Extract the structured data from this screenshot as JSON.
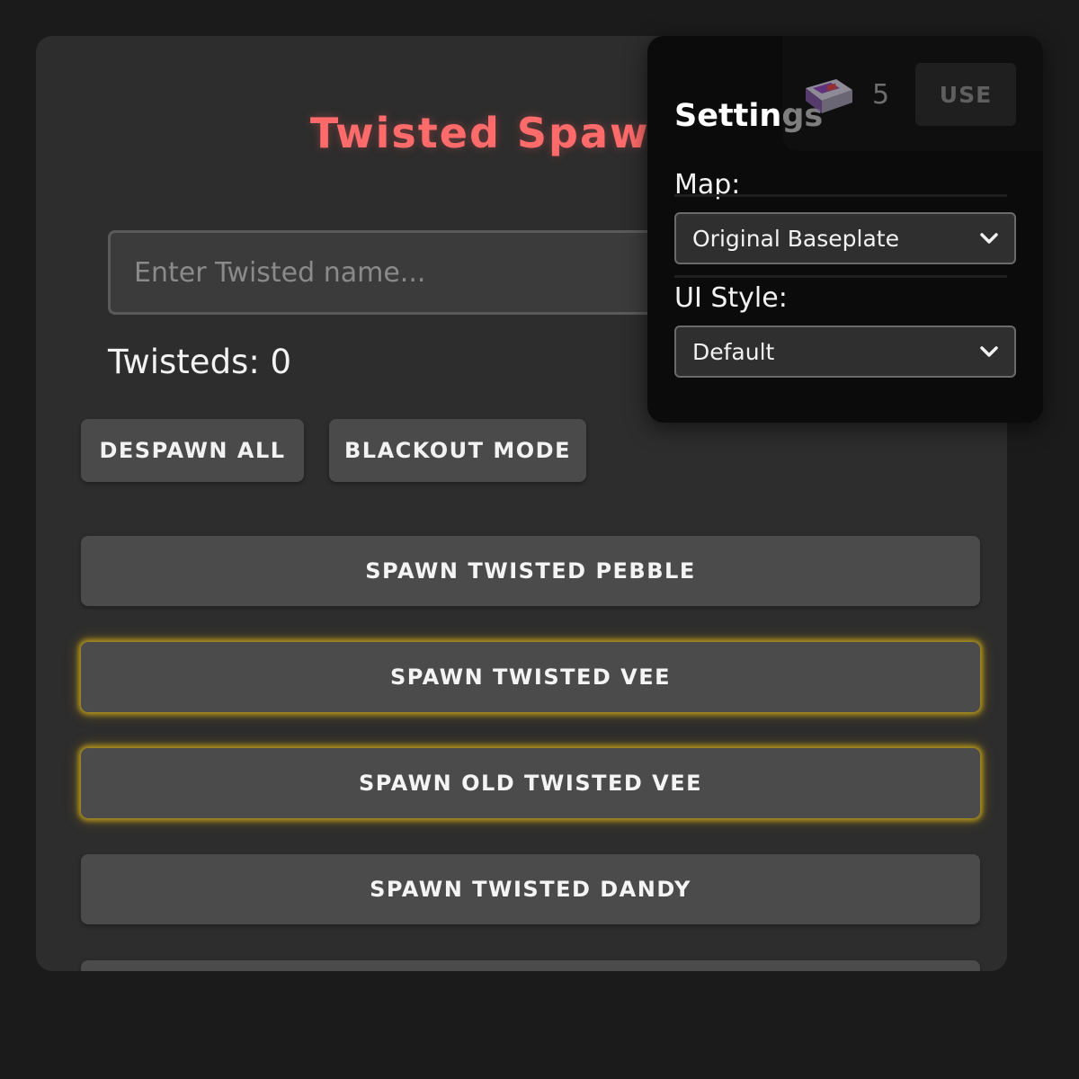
{
  "app": {
    "title": "Twisted Spawner",
    "search": {
      "placeholder": "Enter Twisted name...",
      "value": ""
    },
    "count_label": "Twisteds: 0",
    "actions": {
      "despawn_all": "DESPAWN ALL",
      "blackout_mode": "BLACKOUT MODE"
    },
    "spawn_buttons": [
      {
        "label": "SPAWN TWISTED PEBBLE",
        "highlighted": false
      },
      {
        "label": "SPAWN TWISTED VEE",
        "highlighted": true
      },
      {
        "label": "SPAWN OLD TWISTED VEE",
        "highlighted": true
      },
      {
        "label": "SPAWN TWISTED DANDY",
        "highlighted": false
      },
      {
        "label": "",
        "highlighted": false
      }
    ]
  },
  "settings": {
    "title": "Settings",
    "map": {
      "label": "Map:",
      "selected": "Original Baseplate"
    },
    "ui_style": {
      "label": "UI Style:",
      "selected": "Default"
    }
  },
  "item": {
    "icon": "item-box-icon",
    "count": "5",
    "use_label": "USE"
  },
  "colors": {
    "title": "#ff6b6b",
    "highlight_glow": "#d4af1e",
    "panel": "#2d2d2d",
    "settings_panel": "#0b0b0b"
  }
}
